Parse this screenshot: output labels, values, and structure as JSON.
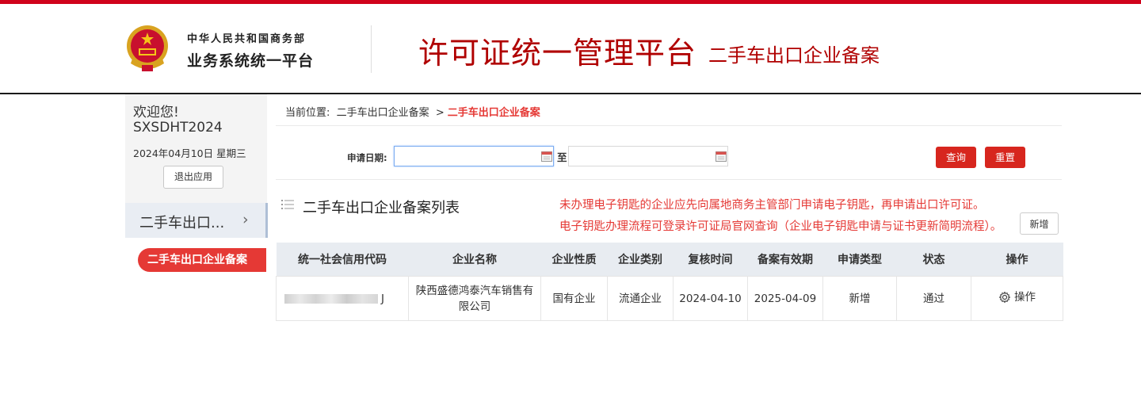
{
  "header": {
    "org_line1": "中华人民共和国商务部",
    "org_line2": "业务系统统一平台",
    "title": "许可证统一管理平台",
    "subtitle": "二手车出口企业备案",
    "accent": "#d0021b"
  },
  "sidebar": {
    "welcome": "欢迎您!",
    "username": "SXSDHT2024",
    "date": "2024年04月10日 星期三",
    "logout_label": "退出应用",
    "menu_group": "二手车出口...",
    "menu_item": "二手车出口企业备案"
  },
  "breadcrumb": {
    "prefix": "当前位置:",
    "parent": "二手车出口企业备案",
    "separator": ">",
    "current": "二手车出口企业备案"
  },
  "filter": {
    "date_label": "申请日期:",
    "from_value": "",
    "to_label": "至",
    "to_value": "",
    "query_label": "查询",
    "reset_label": "重置"
  },
  "list": {
    "title": "二手车出口企业备案列表",
    "notice_line1": "未办理电子钥匙的企业应先向属地商务主管部门申请电子钥匙，再申请出口许可证。",
    "notice_line2": "电子钥匙办理流程可登录许可证局官网查询（企业电子钥匙申请与证书更新简明流程）。",
    "add_label": "新增",
    "columns": [
      "统一社会信用代码",
      "企业名称",
      "企业性质",
      "企业类别",
      "复核时间",
      "备案有效期",
      "申请类型",
      "状态",
      "操作"
    ],
    "rows": [
      {
        "code_suffix": "J",
        "name": "陕西盛德鸿泰汽车销售有限公司",
        "nature": "国有企业",
        "category": "流通企业",
        "review_time": "2024-04-10",
        "valid_until": "2025-04-09",
        "apply_type": "新增",
        "status": "通过",
        "op_label": "操作"
      }
    ]
  },
  "icons": {
    "calendar": "calendar-icon",
    "list": "list-icon",
    "gear": "gear-icon",
    "chevron": "chevron-right-icon",
    "emblem": "national-emblem"
  }
}
